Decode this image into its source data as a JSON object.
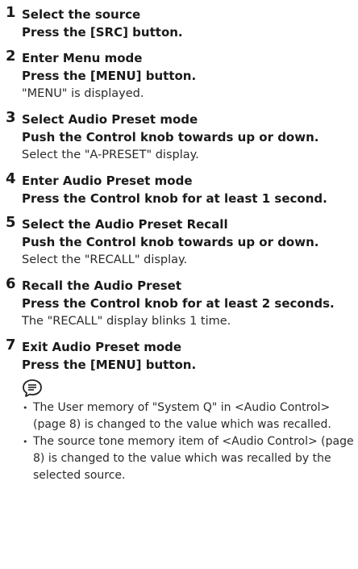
{
  "steps": [
    {
      "number": "1",
      "title": "Select the source",
      "action": "Press the [SRC] button.",
      "note": ""
    },
    {
      "number": "2",
      "title": "Enter Menu mode",
      "action": "Press the [MENU] button.",
      "note": "\"MENU\" is displayed."
    },
    {
      "number": "3",
      "title": "Select Audio Preset mode",
      "action": "Push the Control knob towards up or down.",
      "note": "Select the \"A-PRESET\" display."
    },
    {
      "number": "4",
      "title": "Enter Audio Preset mode",
      "action": "Press the Control knob for at least 1 second.",
      "note": ""
    },
    {
      "number": "5",
      "title": "Select the Audio Preset Recall",
      "action": "Push the Control knob towards up or down.",
      "note": "Select the \"RECALL\" display."
    },
    {
      "number": "6",
      "title": "Recall the Audio Preset",
      "action": "Press the Control knob for at least 2 seconds.",
      "note": "The \"RECALL\" display blinks 1 time."
    },
    {
      "number": "7",
      "title": "Exit Audio Preset mode",
      "action": "Press the [MENU] button.",
      "note": ""
    }
  ],
  "notes_icon": "note-icon",
  "notes": {
    "line1a": "The User memory of \"System Q\" in <Audio Control>",
    "line1b": "(page 8) is changed to the value which was recalled.",
    "line2a": "The source tone memory item of <Audio Control> (page",
    "line2b": "8) is changed to the value which was recalled by the",
    "line2c": "selected source."
  }
}
